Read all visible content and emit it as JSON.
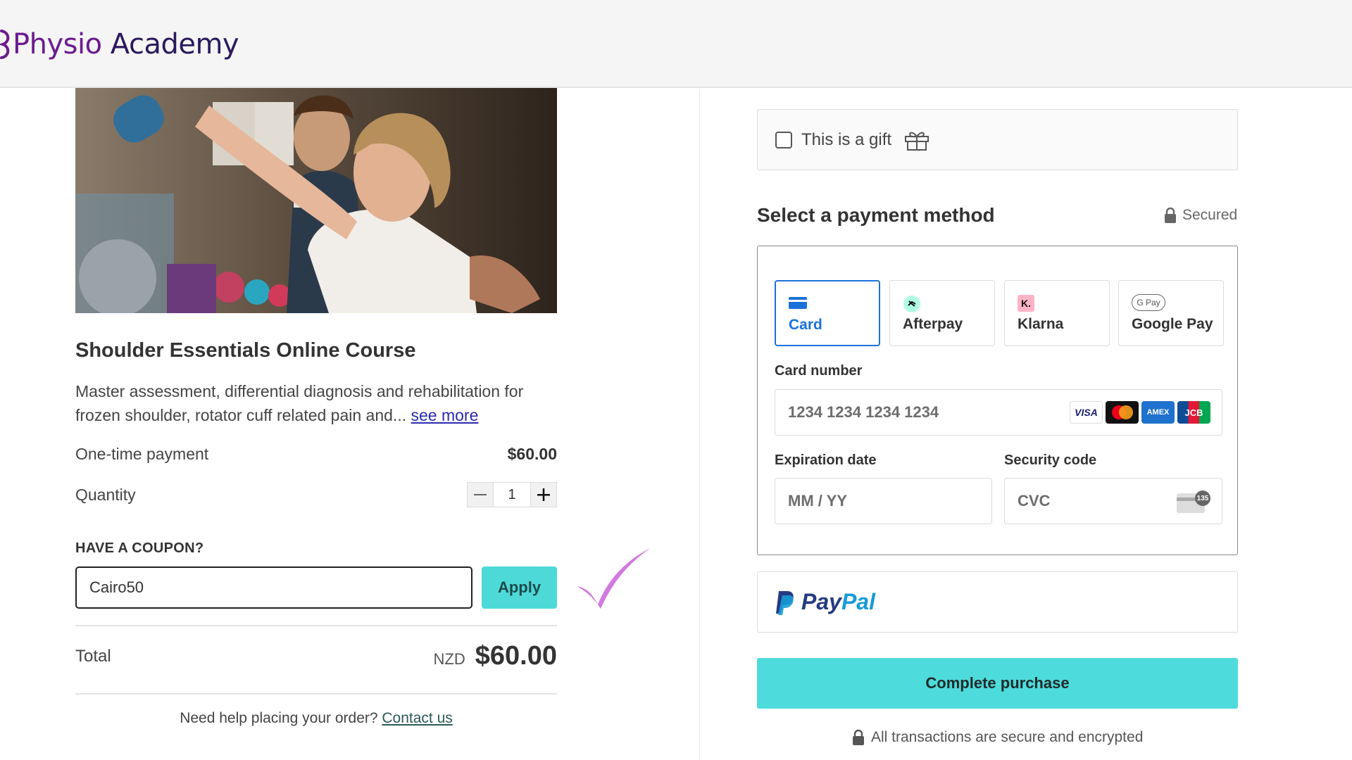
{
  "header": {
    "logo_word1": "Physio",
    "logo_word2": "Academy"
  },
  "product": {
    "title": "Shoulder Essentials Online Course",
    "description": "Master assessment, differential diagnosis and rehabilitation for frozen shoulder, rotator cuff related pain and... ",
    "see_more": "see more",
    "payment_label": "One-time payment",
    "price": "$60.00",
    "quantity_label": "Quantity",
    "quantity": "1"
  },
  "coupon": {
    "label": "HAVE A COUPON?",
    "value": "Cairo50",
    "apply_label": "Apply"
  },
  "total": {
    "label": "Total",
    "currency": "NZD",
    "amount": "$60.00"
  },
  "help": {
    "text": "Need help placing your order? ",
    "link": "Contact us"
  },
  "gift": {
    "label": "This is a gift",
    "checked": false
  },
  "payment": {
    "title": "Select a payment method",
    "secured": "Secured",
    "tabs": [
      {
        "label": "Card",
        "icon": "credit-card-icon",
        "active": true
      },
      {
        "label": "Afterpay",
        "icon": "afterpay-icon",
        "active": false
      },
      {
        "label": "Klarna",
        "icon": "klarna-icon",
        "active": false
      },
      {
        "label": "Google Pay",
        "icon": "google-pay-icon",
        "active": false
      }
    ],
    "klarna_badge": "K.",
    "gpay_badge": "G Pay",
    "card_number_label": "Card number",
    "card_number_placeholder": "1234 1234 1234 1234",
    "brands": [
      "VISA",
      "AMEX",
      "JCB"
    ],
    "expiry_label": "Expiration date",
    "expiry_placeholder": "MM / YY",
    "cvc_label": "Security code",
    "cvc_placeholder": "CVC",
    "cvc_badge": "135",
    "paypal_pay": "Pay",
    "paypal_pal": "Pal",
    "complete_label": "Complete purchase",
    "secure_note": "All transactions are secure and encrypted"
  },
  "colors": {
    "accent": "#4ed9d9",
    "active_tab": "#1a73d9",
    "brand_purple": "#6b1b8f",
    "checkmark": "#d27ae0"
  }
}
